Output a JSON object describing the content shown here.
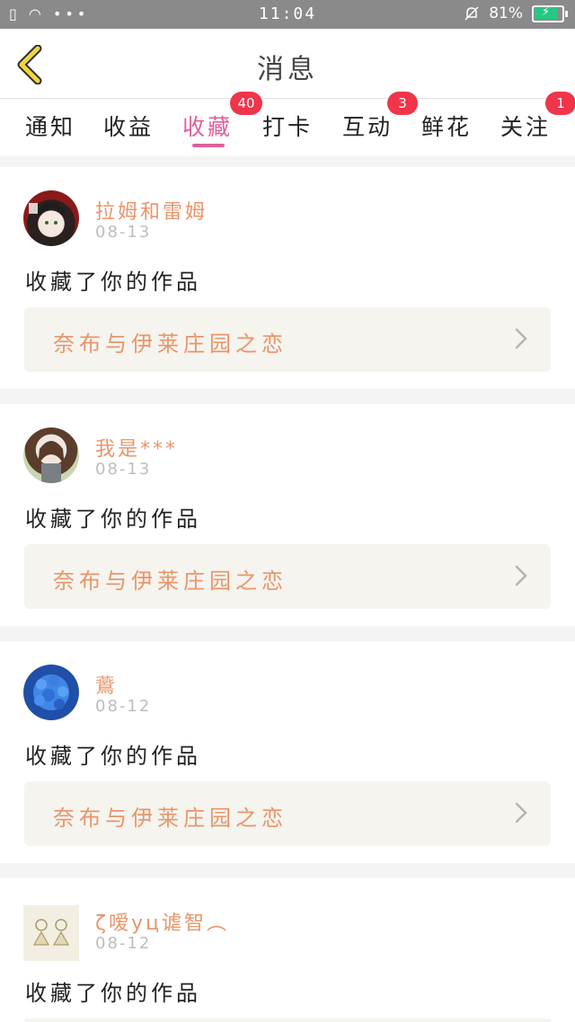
{
  "status_bar": {
    "time": "11:04",
    "battery": "81%",
    "left_icons": "▯ ◠ •••"
  },
  "header": {
    "title": "消息"
  },
  "tabs": [
    {
      "label": "通知"
    },
    {
      "label": "收益"
    },
    {
      "label": "收藏",
      "badge": "40",
      "active": true
    },
    {
      "label": "打卡"
    },
    {
      "label": "互动",
      "badge": "3"
    },
    {
      "label": "鲜花"
    },
    {
      "label": "关注",
      "badge": "1"
    }
  ],
  "messages": [
    {
      "user": "拉姆和雷姆",
      "date": "08-13",
      "action": "收藏了你的作品",
      "work": "奈布与伊莱庄园之恋"
    },
    {
      "user": "我是***",
      "date": "08-13",
      "action": "收藏了你的作品",
      "work": "奈布与伊莱庄园之恋"
    },
    {
      "user": "鷰",
      "date": "08-12",
      "action": "收藏了你的作品",
      "work": "奈布与伊莱庄园之恋"
    },
    {
      "user": "ζ嗳yц谑智︵",
      "date": "08-12",
      "action": "收藏了你的作品",
      "work": ""
    }
  ],
  "colors": {
    "accent_pink": "#e0609a",
    "badge_red": "#f0344a",
    "name_orange": "#e9956a",
    "back_arrow": "#f1d63a"
  },
  "icons": {
    "back": "chevron-left-icon",
    "work_link": "chevron-right-icon"
  }
}
